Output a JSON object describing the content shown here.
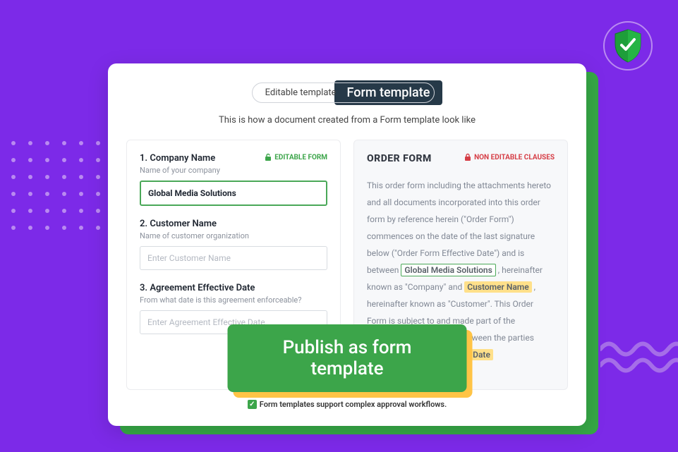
{
  "tabs": {
    "editable_label": "Editable template",
    "form_label": "Form template"
  },
  "subtitle": "This is how a document created from a Form template look like",
  "left_panel": {
    "badge": "EDITABLE FORM",
    "fields": [
      {
        "title": "1. Company Name",
        "sub": "Name of your company",
        "value": "Global Media Solutions",
        "placeholder": ""
      },
      {
        "title": "2. Customer Name",
        "sub": "Name of customer organization",
        "value": "",
        "placeholder": "Enter Customer Name"
      },
      {
        "title": "3. Agreement Effective Date",
        "sub": "From what date is this agreement enforceable?",
        "value": "",
        "placeholder": "Enter Agreement Effective Date"
      }
    ]
  },
  "right_panel": {
    "title": "ORDER FORM",
    "badge": "NON EDITABLE CLAUSES",
    "body_parts": {
      "p1": "This order form including the attachments hereto and all documents incorporated into this order form by reference herein (\"Order Form\") commences on the date of the last signature below (\"Order Form Effective Date\") and is between ",
      "hl1": "Global Media Solutions",
      "p2": ", hereinafter known as \"Company\" and ",
      "hl2": "Customer Name",
      "p3": " , hereinafter known as \"Customer\". This Order Form is subject to and made part of the Subscription Agreement between the parties dated ",
      "hl3": "Agreement Effective Date"
    }
  },
  "publish_label": "Publish as form template",
  "footer_note": "Form templates support complex approval workflows."
}
